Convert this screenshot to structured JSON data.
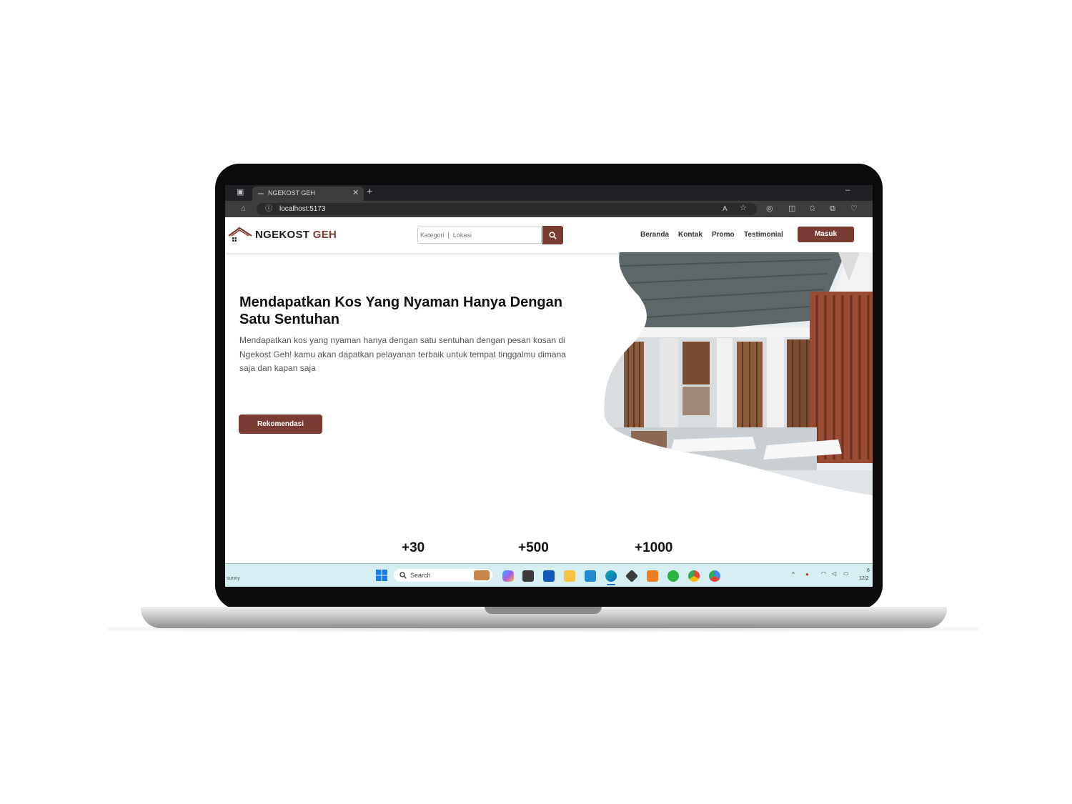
{
  "browser": {
    "tab_title": "NGEKOST GEH",
    "url": "localhost:5173"
  },
  "site": {
    "logo_main": "NGEKOST",
    "logo_accent": "GEH",
    "brand_color": "#7a3b32",
    "search": {
      "placeholder": "Kategori  |  Lokasi"
    },
    "nav": [
      "Beranda",
      "Kontak",
      "Promo",
      "Testimonial"
    ],
    "login_label": "Masuk"
  },
  "hero": {
    "title": "Mendapatkan Kos Yang Nyaman Hanya Dengan Satu Sentuhan",
    "description": "Mendapatkan kos yang nyaman hanya dengan satu sentuhan dengan pesan kosan di Ngekost Geh! kamu akan dapatkan pelayanan terbaik untuk tempat tinggalmu dimana saja dan kapan saja",
    "cta": "Rekomendasi"
  },
  "stats": [
    "+30",
    "+500",
    "+1000"
  ],
  "taskbar": {
    "weather": "sunny",
    "search_label": "Search",
    "time": "6",
    "date": "12/2"
  }
}
